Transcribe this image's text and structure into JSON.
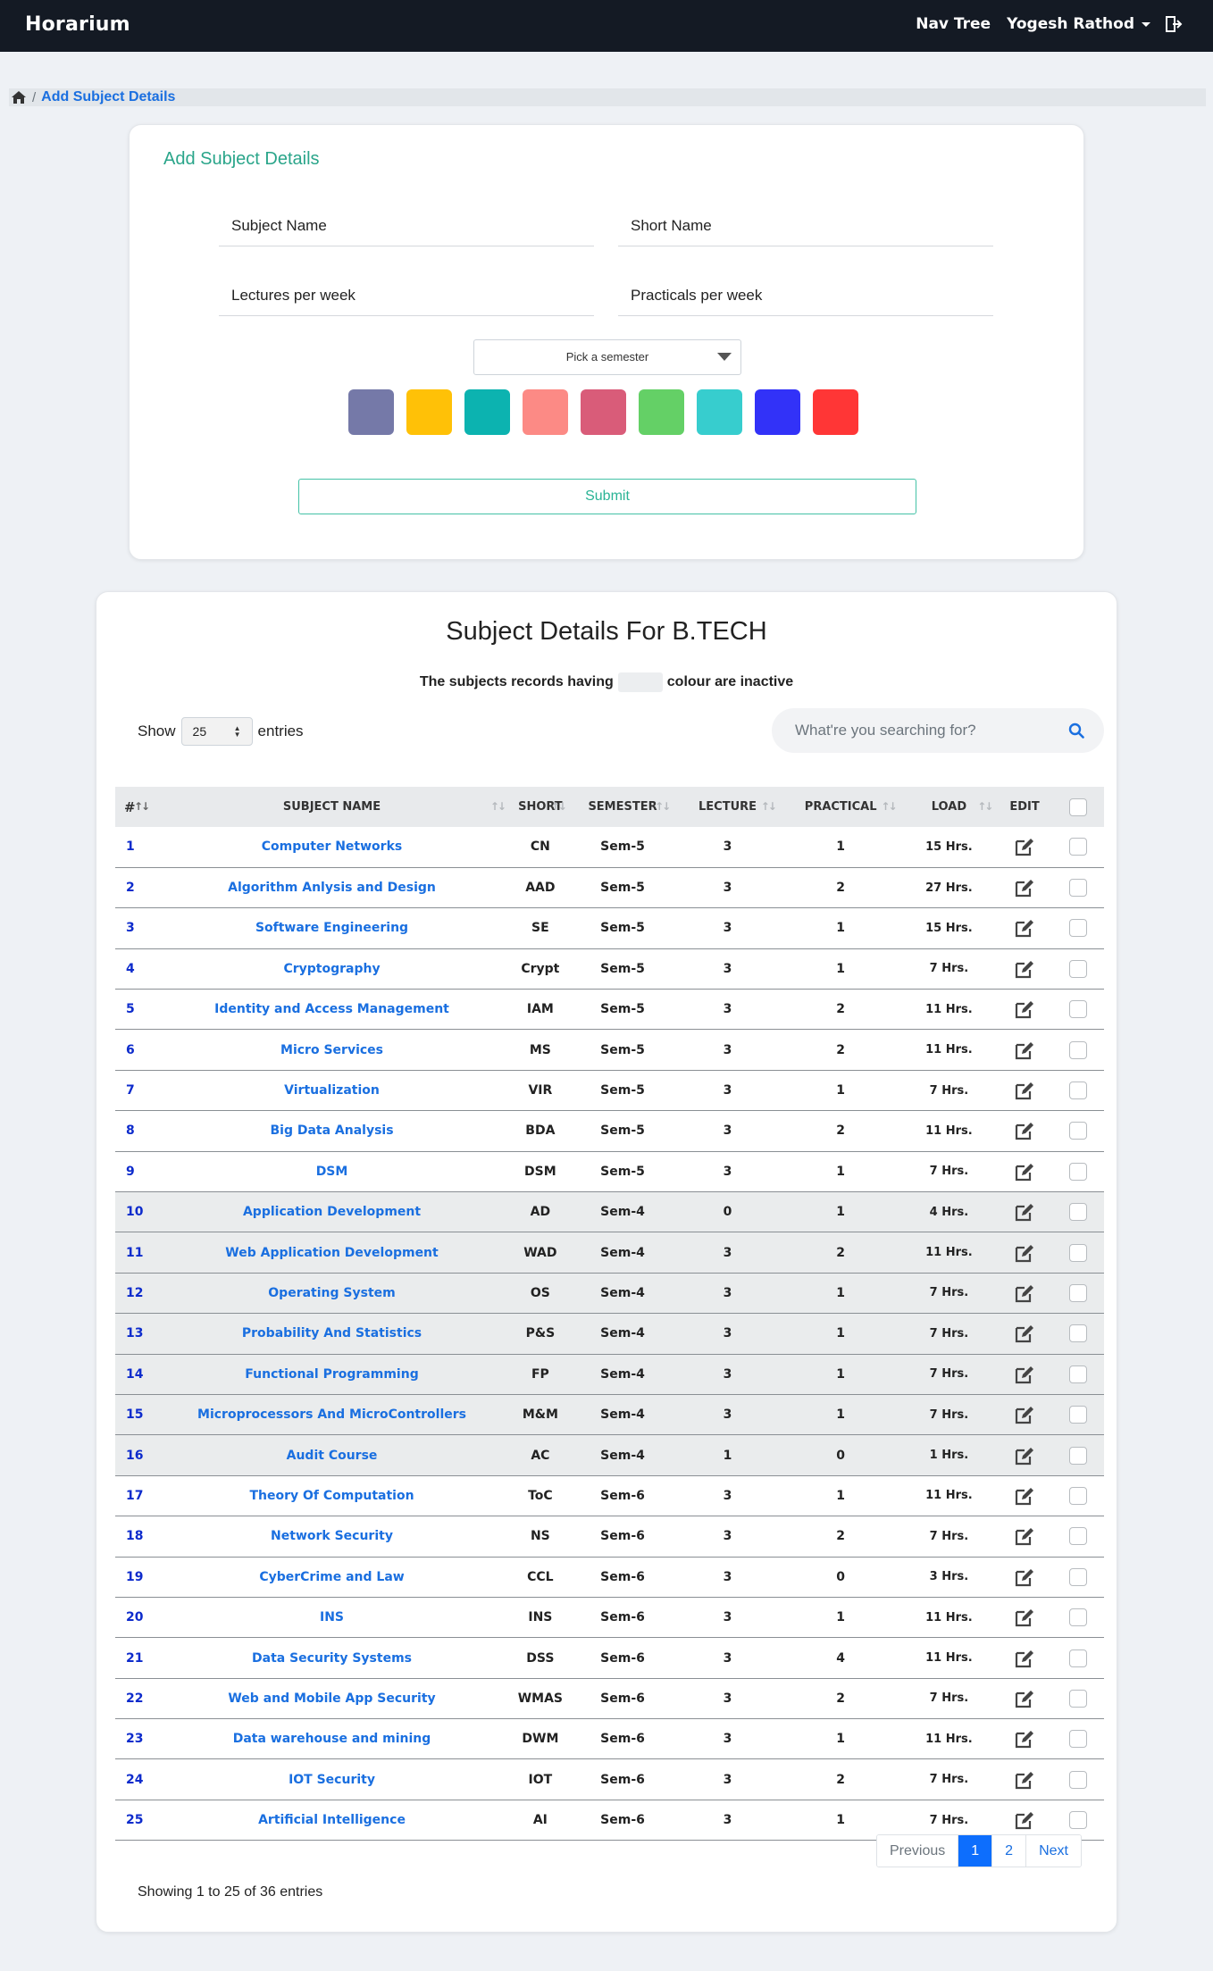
{
  "navbar": {
    "brand": "Horarium",
    "nav_link": "Nav Tree",
    "user_name": "Yogesh Rathod",
    "logout_icon": "logout-icon"
  },
  "breadcrumb": {
    "home_icon": "home-icon",
    "separator": "/",
    "current": "Add Subject Details"
  },
  "form": {
    "title": "Add Subject Details",
    "subject_name_placeholder": "Subject Name",
    "short_name_placeholder": "Short Name",
    "lectures_placeholder": "Lectures per week",
    "practicals_placeholder": "Practicals per week",
    "semester_select": "Pick a semester",
    "colors": [
      "#7579a8",
      "#ffc107",
      "#0cb3b0",
      "#fc8a85",
      "#d95c79",
      "#64d066",
      "#37cdce",
      "#3232f8",
      "#ff3636"
    ],
    "submit_label": "Submit"
  },
  "table_section": {
    "title": "Subject Details For B.TECH",
    "inactive_note_prefix": "The subjects records having",
    "inactive_note_suffix": "colour are inactive",
    "show_label": "Show",
    "entries_value": "25",
    "entries_label": "entries",
    "search_placeholder": "What're you searching for?",
    "columns": [
      "#",
      "SUBJECT NAME",
      "SHORT",
      "SEMESTER",
      "LECTURE",
      "PRACTICAL",
      "LOAD",
      "EDIT"
    ],
    "rows": [
      {
        "num": "1",
        "name": "Computer Networks",
        "short": "CN",
        "semester": "Sem-5",
        "lecture": "3",
        "practical": "1",
        "load": "15 Hrs."
      },
      {
        "num": "2",
        "name": "Algorithm Anlysis and Design",
        "short": "AAD",
        "semester": "Sem-5",
        "lecture": "3",
        "practical": "2",
        "load": "27 Hrs."
      },
      {
        "num": "3",
        "name": "Software Engineering",
        "short": "SE",
        "semester": "Sem-5",
        "lecture": "3",
        "practical": "1",
        "load": "15 Hrs."
      },
      {
        "num": "4",
        "name": "Cryptography",
        "short": "Crypt",
        "semester": "Sem-5",
        "lecture": "3",
        "practical": "1",
        "load": "7 Hrs."
      },
      {
        "num": "5",
        "name": "Identity and Access Management",
        "short": "IAM",
        "semester": "Sem-5",
        "lecture": "3",
        "practical": "2",
        "load": "11 Hrs."
      },
      {
        "num": "6",
        "name": "Micro Services",
        "short": "MS",
        "semester": "Sem-5",
        "lecture": "3",
        "practical": "2",
        "load": "11 Hrs."
      },
      {
        "num": "7",
        "name": "Virtualization",
        "short": "VIR",
        "semester": "Sem-5",
        "lecture": "3",
        "practical": "1",
        "load": "7 Hrs."
      },
      {
        "num": "8",
        "name": "Big Data Analysis",
        "short": "BDA",
        "semester": "Sem-5",
        "lecture": "3",
        "practical": "2",
        "load": "11 Hrs."
      },
      {
        "num": "9",
        "name": "DSM",
        "short": "DSM",
        "semester": "Sem-5",
        "lecture": "3",
        "practical": "1",
        "load": "7 Hrs."
      },
      {
        "num": "10",
        "name": "Application Development",
        "short": "AD",
        "semester": "Sem-4",
        "lecture": "0",
        "practical": "1",
        "load": "4 Hrs."
      },
      {
        "num": "11",
        "name": "Web Application Development",
        "short": "WAD",
        "semester": "Sem-4",
        "lecture": "3",
        "practical": "2",
        "load": "11 Hrs."
      },
      {
        "num": "12",
        "name": "Operating System",
        "short": "OS",
        "semester": "Sem-4",
        "lecture": "3",
        "practical": "1",
        "load": "7 Hrs."
      },
      {
        "num": "13",
        "name": "Probability And Statistics",
        "short": "P&S",
        "semester": "Sem-4",
        "lecture": "3",
        "practical": "1",
        "load": "7 Hrs."
      },
      {
        "num": "14",
        "name": "Functional Programming",
        "short": "FP",
        "semester": "Sem-4",
        "lecture": "3",
        "practical": "1",
        "load": "7 Hrs."
      },
      {
        "num": "15",
        "name": "Microprocessors And MicroControllers",
        "short": "M&M",
        "semester": "Sem-4",
        "lecture": "3",
        "practical": "1",
        "load": "7 Hrs."
      },
      {
        "num": "16",
        "name": "Audit Course",
        "short": "AC",
        "semester": "Sem-4",
        "lecture": "1",
        "practical": "0",
        "load": "1 Hrs."
      },
      {
        "num": "17",
        "name": "Theory Of Computation",
        "short": "ToC",
        "semester": "Sem-6",
        "lecture": "3",
        "practical": "1",
        "load": "11 Hrs."
      },
      {
        "num": "18",
        "name": "Network Security",
        "short": "NS",
        "semester": "Sem-6",
        "lecture": "3",
        "practical": "2",
        "load": "7 Hrs."
      },
      {
        "num": "19",
        "name": "CyberCrime and Law",
        "short": "CCL",
        "semester": "Sem-6",
        "lecture": "3",
        "practical": "0",
        "load": "3 Hrs."
      },
      {
        "num": "20",
        "name": "INS",
        "short": "INS",
        "semester": "Sem-6",
        "lecture": "3",
        "practical": "1",
        "load": "11 Hrs."
      },
      {
        "num": "21",
        "name": "Data Security Systems",
        "short": "DSS",
        "semester": "Sem-6",
        "lecture": "3",
        "practical": "4",
        "load": "11 Hrs."
      },
      {
        "num": "22",
        "name": "Web and Mobile App Security",
        "short": "WMAS",
        "semester": "Sem-6",
        "lecture": "3",
        "practical": "2",
        "load": "7 Hrs."
      },
      {
        "num": "23",
        "name": "Data warehouse and mining",
        "short": "DWM",
        "semester": "Sem-6",
        "lecture": "3",
        "practical": "1",
        "load": "11 Hrs."
      },
      {
        "num": "24",
        "name": "IOT Security",
        "short": "IOT",
        "semester": "Sem-6",
        "lecture": "3",
        "practical": "2",
        "load": "7 Hrs."
      },
      {
        "num": "25",
        "name": "Artificial Intelligence",
        "short": "AI",
        "semester": "Sem-6",
        "lecture": "3",
        "practical": "1",
        "load": "7 Hrs."
      }
    ],
    "info": "Showing 1 to 25 of 36 entries",
    "pagination": {
      "previous": "Previous",
      "pages": [
        "1",
        "2"
      ],
      "next": "Next"
    }
  }
}
